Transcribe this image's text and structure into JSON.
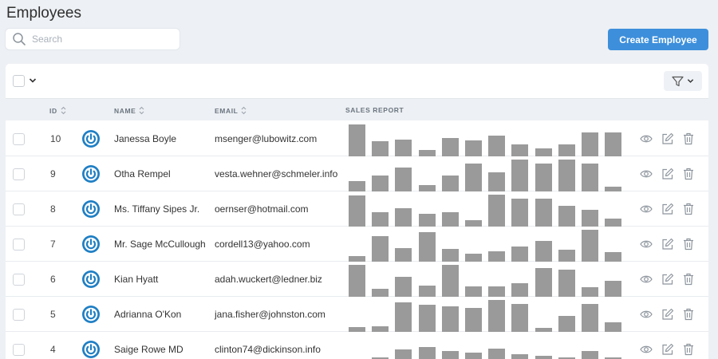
{
  "header": {
    "title": "Employees",
    "search_placeholder": "Search",
    "create_button": "Create Employee"
  },
  "table": {
    "columns": {
      "id": "ID",
      "name": "NAME",
      "email": "EMAIL",
      "sales": "SALES REPORT"
    },
    "rows": [
      {
        "id": "10",
        "name": "Janessa Boyle",
        "email": "msenger@lubowitz.com",
        "sales": [
          1.0,
          0.47,
          0.53,
          0.21,
          0.58,
          0.5,
          0.66,
          0.37,
          0.24,
          0.37,
          0.76,
          0.74
        ]
      },
      {
        "id": "9",
        "name": "Otha Rempel",
        "email": "vesta.wehner@schmeler.info",
        "sales": [
          0.32,
          0.5,
          0.74,
          0.21,
          0.5,
          0.87,
          0.61,
          1.0,
          0.87,
          1.0,
          0.87,
          0.16
        ]
      },
      {
        "id": "8",
        "name": "Ms. Tiffany Sipes Jr.",
        "email": "oernser@hotmail.com",
        "sales": [
          0.97,
          0.45,
          0.58,
          0.39,
          0.45,
          0.21,
          1.0,
          0.87,
          0.87,
          0.66,
          0.53,
          0.26
        ]
      },
      {
        "id": "7",
        "name": "Mr. Sage McCullough",
        "email": "cordell13@yahoo.com",
        "sales": [
          0.18,
          0.79,
          0.42,
          0.92,
          0.39,
          0.24,
          0.32,
          0.47,
          0.66,
          0.37,
          1.0,
          0.29
        ]
      },
      {
        "id": "6",
        "name": "Kian Hyatt",
        "email": "adah.wuckert@ledner.biz",
        "sales": [
          1.0,
          0.26,
          0.63,
          0.34,
          1.0,
          0.32,
          0.32,
          0.42,
          0.89,
          0.84,
          0.29,
          0.5
        ]
      },
      {
        "id": "5",
        "name": "Adrianna O'Kon",
        "email": "jana.fisher@johnston.com",
        "sales": [
          0.16,
          0.18,
          0.92,
          0.84,
          0.79,
          0.76,
          1.0,
          0.87,
          0.13,
          0.5,
          0.87,
          0.29
        ]
      },
      {
        "id": "4",
        "name": "Saige Rowe MD",
        "email": "clinton74@dickinson.info",
        "sales": [
          0.24,
          0.3,
          0.55,
          0.62,
          0.5,
          0.45,
          0.58,
          0.4,
          0.35,
          0.3,
          0.5,
          0.3
        ]
      }
    ]
  },
  "colors": {
    "accent": "#3d8fdb",
    "bar": "#9a9a9a",
    "background": "#edf0f4"
  },
  "icons": [
    "search-icon",
    "chevron-down-icon",
    "filter-icon",
    "sort-icon",
    "avatar-icon",
    "eye-icon",
    "edit-icon",
    "trash-icon"
  ]
}
